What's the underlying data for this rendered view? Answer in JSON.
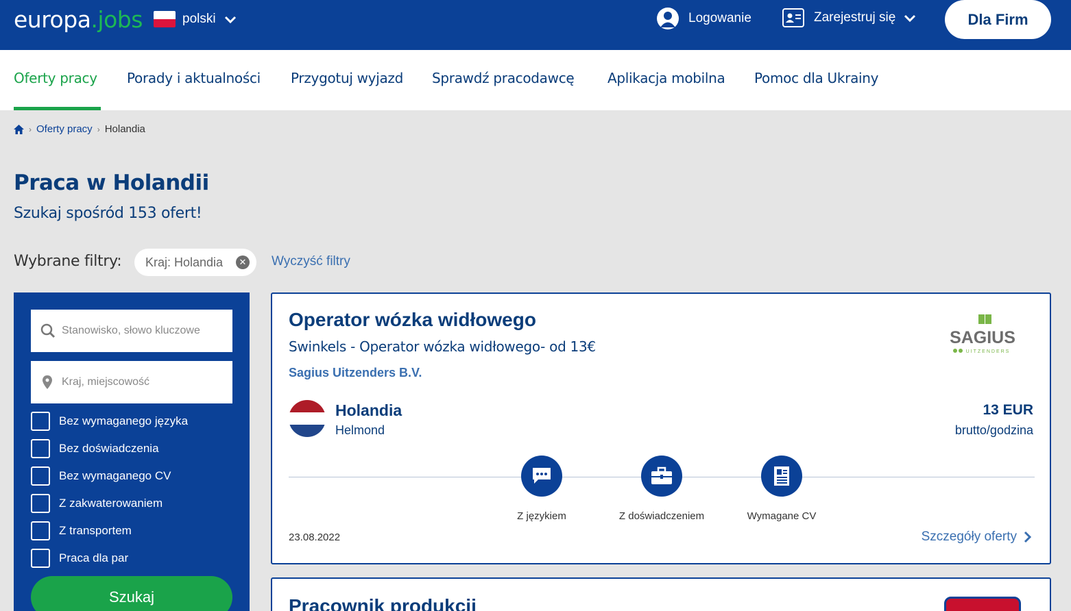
{
  "header": {
    "logo_main": "europa",
    "logo_dot": ".",
    "logo_jobs": "jobs",
    "language": "polski",
    "login_label": "Logowanie",
    "register_label": "Zarejestruj się",
    "employers_label": "Dla Firm"
  },
  "nav": {
    "items": [
      {
        "label": "Oferty pracy"
      },
      {
        "label": "Porady i aktualności"
      },
      {
        "label": "Przygotuj wyjazd"
      },
      {
        "label": "Sprawdź pracodawcę"
      },
      {
        "label": "Aplikacja mobilna"
      },
      {
        "label": "Pomoc dla Ukrainy"
      }
    ]
  },
  "breadcrumb": {
    "sep": "›",
    "items": [
      {
        "label": "Oferty pracy"
      },
      {
        "label": "Holandia"
      }
    ]
  },
  "main": {
    "title": "Praca w Holandii",
    "subtitle": "Szukaj spośród 153 ofert!",
    "filters_label": "Wybrane filtry:",
    "filter_chip": "Kraj: Holandia",
    "clear_filters": "Wyczyść filtry"
  },
  "sidebar": {
    "keyword_placeholder": "Stanowisko, słowo kluczowe",
    "location_placeholder": "Kraj, miejscowość",
    "checkboxes": [
      {
        "label": "Bez wymaganego języka"
      },
      {
        "label": "Bez doświadczenia"
      },
      {
        "label": "Bez wymaganego CV"
      },
      {
        "label": "Z zakwaterowaniem"
      },
      {
        "label": "Z transportem"
      },
      {
        "label": "Praca dla par"
      }
    ],
    "search_button": "Szukaj"
  },
  "jobs": [
    {
      "title": "Operator wózka widłowego",
      "subtitle": "Swinkels - Operator wózka widłowego- od 13€",
      "company": "Sagius Uitzenders B.V.",
      "company_logo_text": "SAGIUS",
      "company_logo_sub": "UITZENDERS",
      "country": "Holandia",
      "city": "Helmond",
      "salary": "13 EUR",
      "salary_unit": "brutto/godzina",
      "features": [
        {
          "label": "Z językiem",
          "icon": "chat-icon"
        },
        {
          "label": "Z doświadczeniem",
          "icon": "briefcase-icon"
        },
        {
          "label": "Wymagane CV",
          "icon": "document-icon"
        }
      ],
      "date": "23.08.2022",
      "details_label": "Szczegóły oferty"
    },
    {
      "title": "Pracownik produkcji"
    }
  ],
  "colors": {
    "primary": "#0b4197",
    "accent_green": "#1aa34a",
    "background": "#e5e5e5"
  }
}
